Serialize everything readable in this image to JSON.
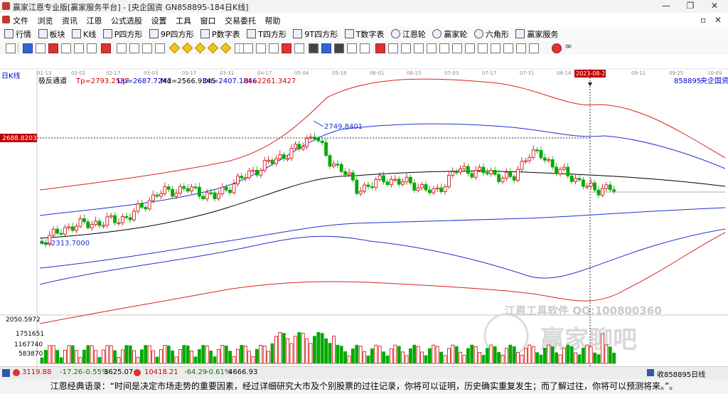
{
  "window": {
    "title": "赢家江恩专业版[赢家服务平台] - [央企国资  GN858895-184日K线]",
    "minimize": "—",
    "maximize": "❐",
    "close": "✕"
  },
  "menu": {
    "items": [
      "文件",
      "浏览",
      "资讯",
      "江恩",
      "公式选股",
      "设置",
      "工具",
      "窗口",
      "交易委托",
      "帮助"
    ],
    "restore": "▫",
    "close": "✕"
  },
  "nav": {
    "items": [
      "行情",
      "板块",
      "K线",
      "P四方形",
      "9P四方形",
      "P数字表",
      "T四方形",
      "9T四方形",
      "T数字表",
      "江恩轮",
      "赢家轮",
      "六角形",
      "赢家服务"
    ]
  },
  "chart_header": {
    "period": "日K线",
    "indicator": "极反通道",
    "tp": "Tp=2793.2537",
    "up": "Up=2687.7241",
    "md": "Md=2566.9345",
    "dn": "Dn=2407.1846",
    "bt": "Bt=2261.3427",
    "code": "858895",
    "name": "央企国资"
  },
  "date_axis": [
    "01-13",
    "02-02",
    "02-17",
    "03-03",
    "03-17",
    "03-31",
    "04-17",
    "05-04",
    "05-18",
    "06-01",
    "06-15",
    "07-03",
    "07-17",
    "07-31",
    "08-14",
    "2023-08-23",
    "09-11",
    "09-25",
    "10-09"
  ],
  "crosshair": {
    "price": "2688.8203",
    "date": "2023-08-23"
  },
  "annotations": {
    "high": "2749.8401",
    "low": "2313.7000"
  },
  "volume_axis": {
    "top": "2050.5972",
    "l1": "1751651",
    "l2": "1167740",
    "l3": "583870"
  },
  "watermark": {
    "text1": "江恩工具软件  QQ:100800360",
    "text2": "赢家聊吧",
    "text3": "liaoba.yjs"
  },
  "status": {
    "sh_price": "3119.88",
    "sh_change": "-17.26",
    "sh_pct": "-0.55%",
    "sh_amount": "3625.07",
    "sz_price": "10418.21",
    "sz_change": "-64.29",
    "sz_pct": "-0.61%",
    "sz_amount": "4666.93",
    "right": "收858895日线"
  },
  "quote": "江恩经典语录：“时间是决定市场走势的重要因素，经过详细研究大市及个别股票的过往记录，你将可以证明，历史确实重复发生；而了解过往，你将可以预测将来。”。",
  "chart_data": {
    "type": "candlestick",
    "title": "央企国资 日K线",
    "indicator": "极反通道",
    "channel": {
      "Tp": 2793.2537,
      "Up": 2687.7241,
      "Md": 2566.9345,
      "Dn": 2407.1846,
      "Bt": 2261.3427
    },
    "annotated_high": 2749.8401,
    "annotated_low": 2313.7,
    "x_ticks": [
      "01-13",
      "02-02",
      "02-17",
      "03-03",
      "03-17",
      "03-31",
      "04-17",
      "05-04",
      "05-18",
      "06-01",
      "06-15",
      "07-03",
      "07-17",
      "07-31",
      "08-14",
      "08-23",
      "09-11",
      "09-25",
      "10-09"
    ],
    "colors": {
      "up": "#d00000",
      "down": "#00aa00",
      "tp": "#d92020",
      "up_line": "#2030d0",
      "md": "#000000",
      "background": "#ffffff"
    }
  }
}
